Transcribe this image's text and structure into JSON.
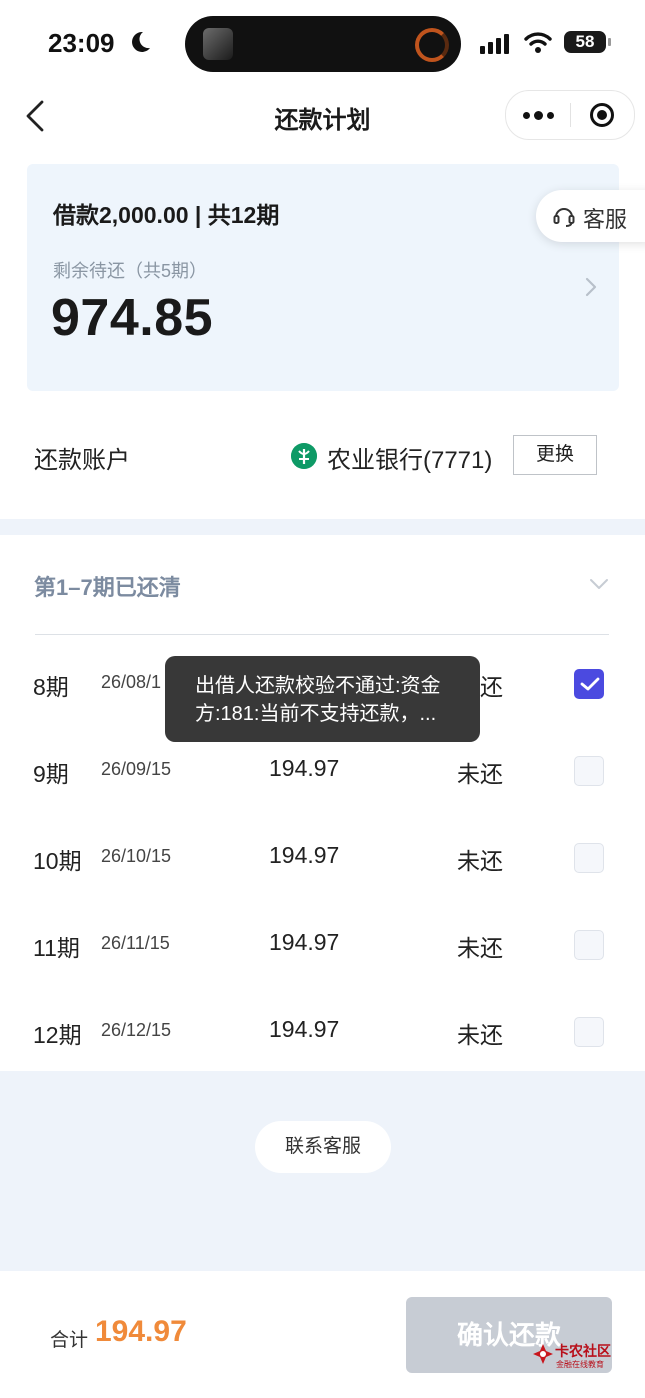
{
  "status_bar": {
    "time": "23:09",
    "battery": "58"
  },
  "nav": {
    "title": "还款计划"
  },
  "summary": {
    "loan_info": "借款2,000.00 | 共12期",
    "remaining_label": "剩余待还（共5期）",
    "remaining_amount": "974.85"
  },
  "customer_service": {
    "label": "客服"
  },
  "account": {
    "label": "还款账户",
    "bank": "农业银行(7771)",
    "change_label": "更换"
  },
  "paid_summary": "第1–7期已还清",
  "plan_rows": [
    {
      "period": "8期",
      "date": "26/08/1",
      "amount": "",
      "status": "还",
      "checked": true
    },
    {
      "period": "9期",
      "date": "26/09/15",
      "amount": "194.97",
      "status": "未还",
      "checked": false
    },
    {
      "period": "10期",
      "date": "26/10/15",
      "amount": "194.97",
      "status": "未还",
      "checked": false
    },
    {
      "period": "11期",
      "date": "26/11/15",
      "amount": "194.97",
      "status": "未还",
      "checked": false
    },
    {
      "period": "12期",
      "date": "26/12/15",
      "amount": "194.97",
      "status": "未还",
      "checked": false
    }
  ],
  "toast": {
    "line1": "出借人还款校验不通过:资金",
    "line2": "方:181:当前不支持还款，..."
  },
  "contact_button": "联系客服",
  "footer": {
    "total_label": "合计",
    "total_amount": "194.97",
    "confirm_label": "确认还款"
  },
  "watermark": {
    "title": "卡农社区",
    "subtitle": "金融在线教育"
  },
  "colors": {
    "accent": "#4b4ae0",
    "total": "#f08a3a",
    "card_bg": "#eef5fc",
    "bank": "#0e9a66"
  }
}
